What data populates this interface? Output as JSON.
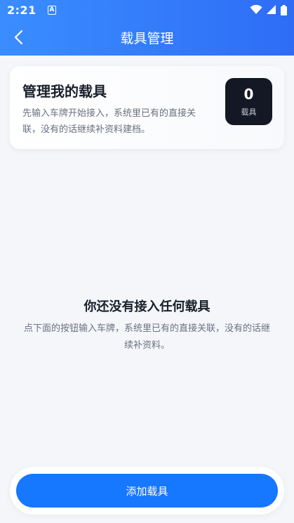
{
  "status_bar": {
    "time": "2:21",
    "notif_letter": "A"
  },
  "header": {
    "title": "载具管理"
  },
  "summary_card": {
    "title": "管理我的载具",
    "description": "先输入车牌开始接入，系统里已有的直接关联，没有的话继续补资料建档。",
    "count": "0",
    "count_label": "载具"
  },
  "empty_state": {
    "title": "你还没有接入任何载具",
    "description": "点下面的按钮输入车牌，系统里已有的直接关联，没有的话继续补资料。"
  },
  "footer": {
    "add_button_label": "添加载具"
  },
  "colors": {
    "header_blue": "#2e6cf6",
    "primary_button": "#1677ff",
    "count_box": "#141824"
  }
}
